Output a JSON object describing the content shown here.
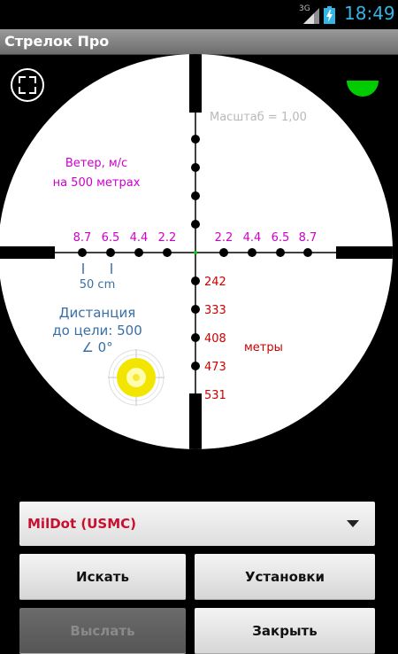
{
  "status_bar": {
    "network": "3G",
    "time": "18:49",
    "icons": [
      "signal-icon",
      "battery-charging-icon"
    ]
  },
  "app": {
    "title": "Стрелок Про"
  },
  "scope": {
    "scale_label": "Масштаб = 1,00",
    "wind_title_line1": "Ветер, м/с",
    "wind_title_line2": "на 500 метрах",
    "wind_left": [
      "8.7",
      "6.5",
      "4.4",
      "2.2"
    ],
    "wind_right": [
      "2.2",
      "4.4",
      "6.5",
      "8.7"
    ],
    "size_label": "50 cm",
    "distance_line1": "Дистанция",
    "distance_line2": "до цели: 500",
    "angle_label": "∠ 0°",
    "distances": [
      "242",
      "333",
      "408",
      "473",
      "531"
    ],
    "meters_label": "метры",
    "icons": [
      "fullscreen-icon",
      "level-indicator-icon",
      "target-icon"
    ],
    "colors": {
      "wind": "#cc00cc",
      "range": "#cc0000",
      "distance": "#3a6fa6",
      "level": "#00cc00",
      "target": "#f2e600"
    }
  },
  "reticle_select": {
    "value": "MilDot (USMC)",
    "icon": "dropdown-arrow-icon"
  },
  "buttons": {
    "search": "Искать",
    "settings": "Установки",
    "send": "Выслать",
    "close": "Закрыть"
  }
}
